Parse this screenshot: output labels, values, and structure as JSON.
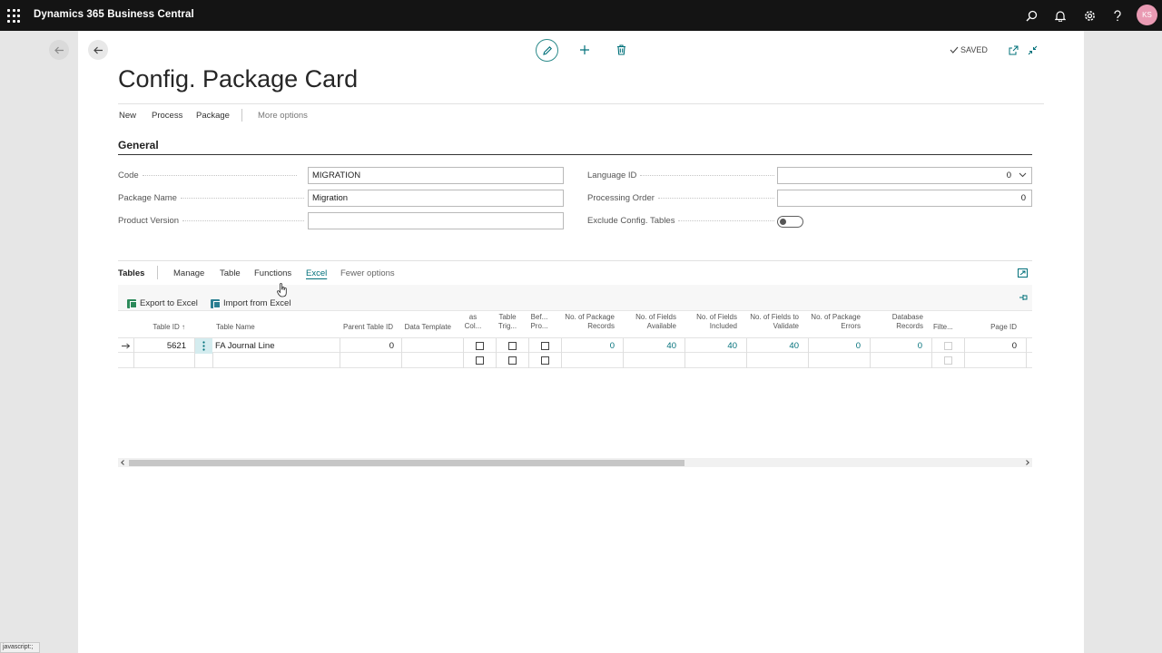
{
  "app": {
    "title": "Dynamics 365 Business Central",
    "user_initials": "KS",
    "icons": [
      "search-icon",
      "bell-icon",
      "gear-icon",
      "help-icon"
    ]
  },
  "card": {
    "title": "Config. Package Card",
    "status": "SAVED",
    "actions": [
      "New",
      "Process",
      "Package",
      "More options"
    ]
  },
  "general": {
    "heading": "General",
    "code_label": "Code",
    "code_value": "MIGRATION",
    "package_name_label": "Package Name",
    "package_name_value": "Migration",
    "product_version_label": "Product Version",
    "product_version_value": "",
    "language_id_label": "Language ID",
    "language_id_value": "0",
    "processing_order_label": "Processing Order",
    "processing_order_value": "0",
    "exclude_config_label": "Exclude Config. Tables",
    "exclude_config_value": false
  },
  "tables": {
    "heading": "Tables",
    "tabs": [
      "Manage",
      "Table",
      "Functions",
      "Excel",
      "Fewer options"
    ],
    "active_tab": "Excel",
    "tools": [
      "Export to Excel",
      "Import from Excel"
    ],
    "columns": {
      "table_id": "Table ID",
      "table_name": "Table Name",
      "parent_table_id": "Parent Table ID",
      "data_template": "Data Template",
      "as_col_1": "as",
      "as_col_2": "Col...",
      "table_trig_1": "Table",
      "table_trig_2": "Trig...",
      "bef_pro_1": "Bef...",
      "bef_pro_2": "Pro...",
      "pkg_records_1": "No. of Package",
      "pkg_records_2": "Records",
      "fields_avail_1": "No. of Fields",
      "fields_avail_2": "Available",
      "fields_incl_1": "No. of Fields",
      "fields_incl_2": "Included",
      "fields_val_1": "No. of Fields to",
      "fields_val_2": "Validate",
      "pkg_errors_1": "No. of Package",
      "pkg_errors_2": "Errors",
      "db_records_1": "Database",
      "db_records_2": "Records",
      "filter": "Filte...",
      "page_id": "Page ID"
    },
    "rows": [
      {
        "table_id": "5621",
        "table_name": "FA Journal Line",
        "parent_table_id": "0",
        "data_template": "",
        "pkg_records": "0",
        "fields_available": "40",
        "fields_included": "40",
        "fields_to_validate": "40",
        "pkg_errors": "0",
        "db_records": "0",
        "page_id": "0"
      }
    ]
  },
  "statusbar": {
    "text": "javascript:;"
  }
}
